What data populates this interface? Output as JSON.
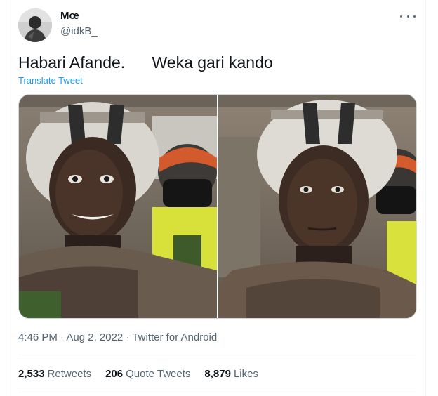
{
  "tweet": {
    "author_name": "Mœ",
    "author_handle": "@idkB_",
    "text": "Habari Afande.      Weka gari kando",
    "translate_label": "Translate Tweet",
    "timestamp": "4:46 PM · Aug 2, 2022",
    "source": "Twitter for Android",
    "separator": " · "
  },
  "stats": {
    "retweets_count": "2,533",
    "retweets_label": "Retweets",
    "quote_count": "206",
    "quote_label": "Quote Tweets",
    "likes_count": "8,879",
    "likes_label": "Likes"
  },
  "colors": {
    "accent": "#1d9bf0",
    "secondary_text": "#536471",
    "primary_text": "#0f1419",
    "border": "#cfd9de"
  },
  "icons": {
    "more": "more-horizontal-icon"
  }
}
